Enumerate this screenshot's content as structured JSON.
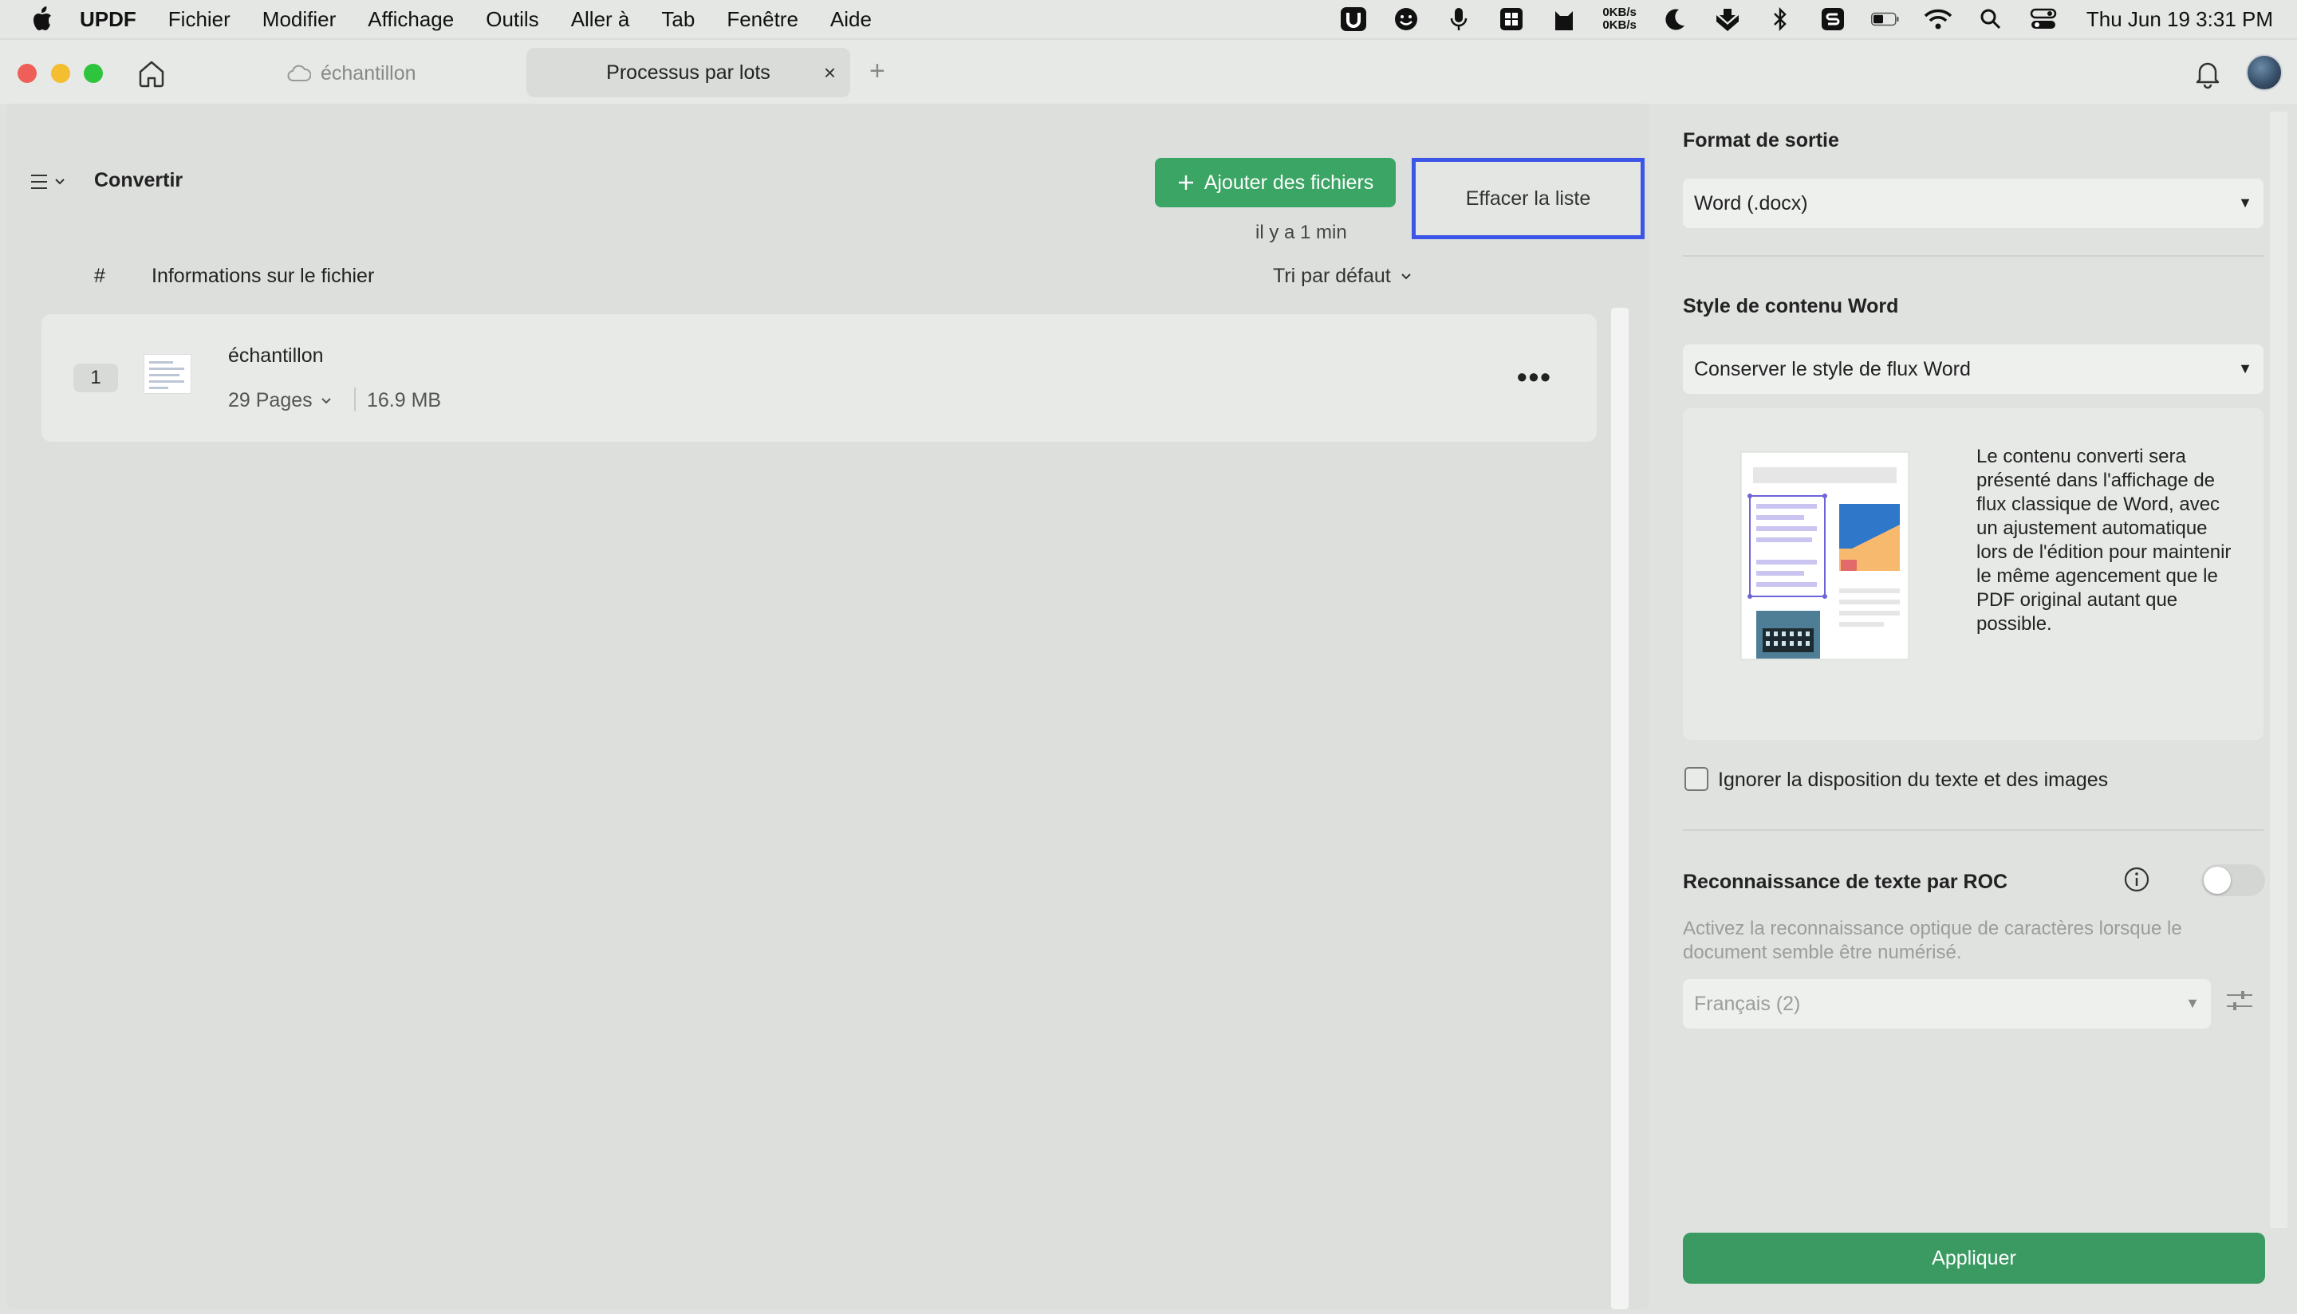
{
  "menubar": {
    "app_name": "UPDF",
    "items": [
      "Fichier",
      "Modifier",
      "Affichage",
      "Outils",
      "Aller à",
      "Tab",
      "Fenêtre",
      "Aide"
    ],
    "netspeed_up": "0KB/s",
    "netspeed_down": "0KB/s",
    "clock": "Thu Jun 19  3:31 PM"
  },
  "tabs": {
    "tab1_label": "échantillon",
    "tab2_label": "Processus par lots",
    "close": "×",
    "add": "+"
  },
  "left": {
    "title": "Convertir",
    "add_files_label": "Ajouter des fichiers",
    "clear_list_label": "Effacer la liste",
    "col_hash": "#",
    "col_info": "Informations sur le fichier",
    "sort_label": "Tri par défaut",
    "files": [
      {
        "index": "1",
        "name": "échantillon",
        "pages": "29 Pages",
        "size": "16.9 MB",
        "time": "il y a 1 min",
        "more": "•••"
      }
    ]
  },
  "right": {
    "output_format_label": "Format de sortie",
    "output_format_value": "Word (.docx)",
    "word_style_label": "Style de contenu Word",
    "word_style_value": "Conserver le style de flux Word",
    "preview_description": "Le contenu converti sera présenté dans l'affichage de flux classique de Word, avec un ajustement automatique lors de l'édition pour maintenir le même agencement que le PDF original autant que possible.",
    "ignore_layout_label": "Ignorer la disposition du texte et des images",
    "ignore_layout_checked": false,
    "ocr_label": "Reconnaissance de texte par ROC",
    "ocr_enabled": false,
    "ocr_description": "Activez la reconnaissance optique de caractères lorsque le document semble être numérisé.",
    "ocr_language": "Français (2)",
    "apply_label": "Appliquer"
  },
  "colors": {
    "accent_green": "#3aa564",
    "apply_green": "#3a9a62",
    "highlight_blue": "#3d55e6"
  }
}
